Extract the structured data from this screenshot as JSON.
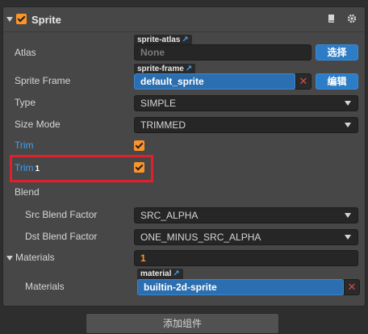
{
  "component": {
    "title": "Sprite",
    "icons": {
      "help": "book-icon",
      "settings": "gear-icon"
    }
  },
  "atlas": {
    "label": "Atlas",
    "tag": "sprite-atlas",
    "value": "None",
    "button": "选择"
  },
  "sprite_frame": {
    "label": "Sprite Frame",
    "tag": "sprite-frame",
    "value": "default_sprite",
    "button": "编辑"
  },
  "type": {
    "label": "Type",
    "value": "SIMPLE"
  },
  "size_mode": {
    "label": "Size Mode",
    "value": "TRIMMED"
  },
  "trim": {
    "label": "Trim",
    "checked": true
  },
  "trim1": {
    "label": "Trim",
    "suffix": "1",
    "checked": true
  },
  "blend": {
    "label": "Blend"
  },
  "src_blend": {
    "label": "Src Blend Factor",
    "value": "SRC_ALPHA"
  },
  "dst_blend": {
    "label": "Dst Blend Factor",
    "value": "ONE_MINUS_SRC_ALPHA"
  },
  "materials_group": {
    "label": "Materials",
    "count": "1"
  },
  "materials_item": {
    "label": "Materials",
    "tag": "material",
    "value": "builtin-2d-sprite"
  },
  "add_component": {
    "label": "添加组件"
  },
  "colors": {
    "accent": "#fd942b",
    "link": "#3ea0f5",
    "asset_blue": "#2c6fb0",
    "highlight": "#e0202a"
  }
}
